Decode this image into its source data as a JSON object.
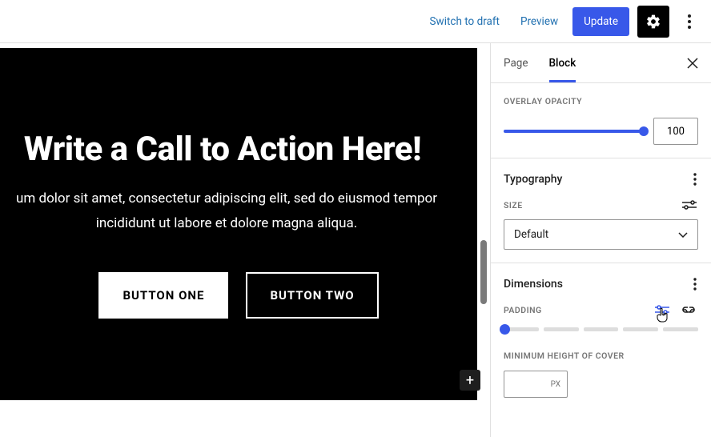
{
  "topbar": {
    "switch_to_draft": "Switch to draft",
    "preview": "Preview",
    "update": "Update"
  },
  "sidebar": {
    "tabs": {
      "page": "Page",
      "block": "Block",
      "active": "block"
    },
    "overlay": {
      "label": "OVERLAY OPACITY",
      "value": "100"
    },
    "typography": {
      "title": "Typography",
      "size_label": "SIZE",
      "size_value": "Default"
    },
    "dimensions": {
      "title": "Dimensions",
      "padding_label": "PADDING",
      "min_height_label": "MINIMUM HEIGHT OF COVER",
      "min_height_unit": "PX",
      "padding_segments": 5,
      "padding_value": 0
    }
  },
  "canvas": {
    "heading": "Write a Call to Action Here!",
    "paragraph": "um dolor sit amet, consectetur adipiscing elit, sed do eiusmod tempor incididunt ut labore et dolore magna aliqua.",
    "button_one": "BUTTON ONE",
    "button_two": "BUTTON TWO"
  }
}
